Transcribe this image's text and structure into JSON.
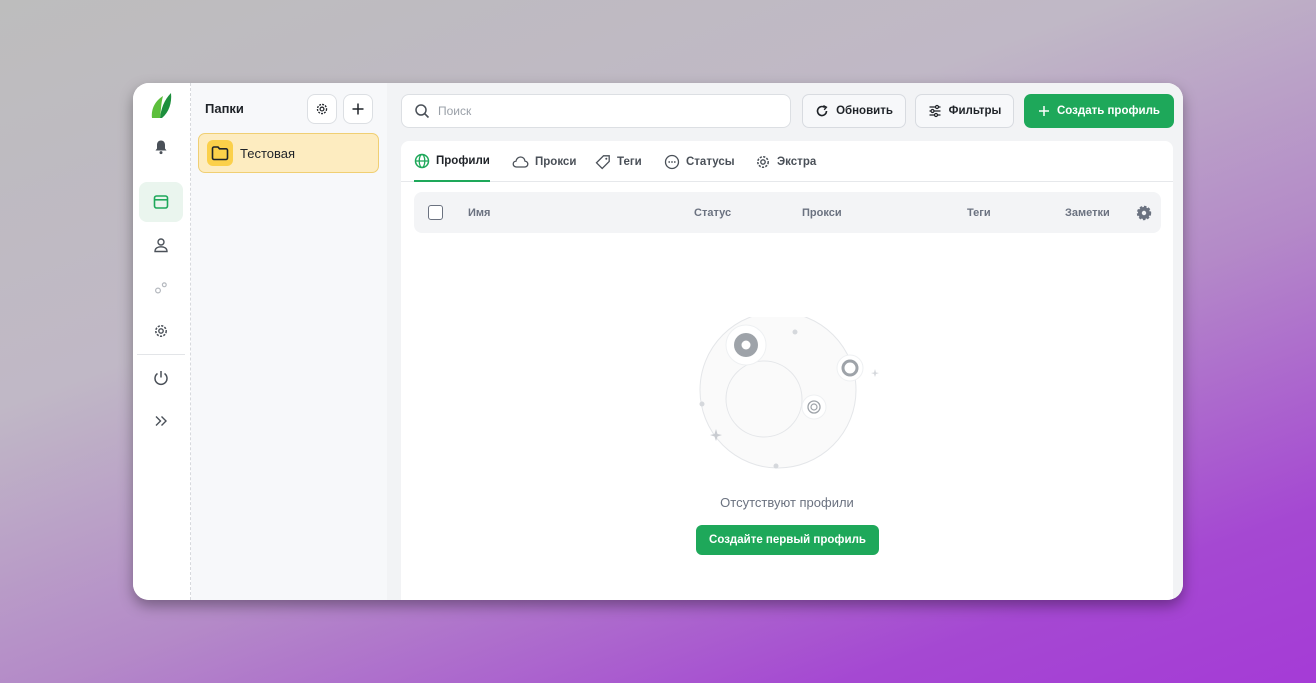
{
  "folders": {
    "title": "Папки",
    "items": [
      {
        "label": "Тестовая"
      }
    ]
  },
  "search": {
    "placeholder": "Поиск"
  },
  "toolbar": {
    "refresh_label": "Обновить",
    "filters_label": "Фильтры",
    "create_label": "Создать профиль"
  },
  "tabs": [
    {
      "label": "Профили",
      "icon": "globe-icon",
      "active": true
    },
    {
      "label": "Прокси",
      "icon": "cloud-icon"
    },
    {
      "label": "Теги",
      "icon": "tag-icon"
    },
    {
      "label": "Статусы",
      "icon": "dots-circle-icon"
    },
    {
      "label": "Экстра",
      "icon": "gear-icon"
    }
  ],
  "table": {
    "columns": [
      "Имя",
      "Статус",
      "Прокси",
      "Теги",
      "Заметки"
    ]
  },
  "empty_state": {
    "text": "Отсутствуют профили",
    "button_label": "Создайте первый профиль"
  },
  "colors": {
    "accent": "#1ea85a",
    "folder_bg": "#fdecc0",
    "folder_icon": "#fbd04a"
  }
}
